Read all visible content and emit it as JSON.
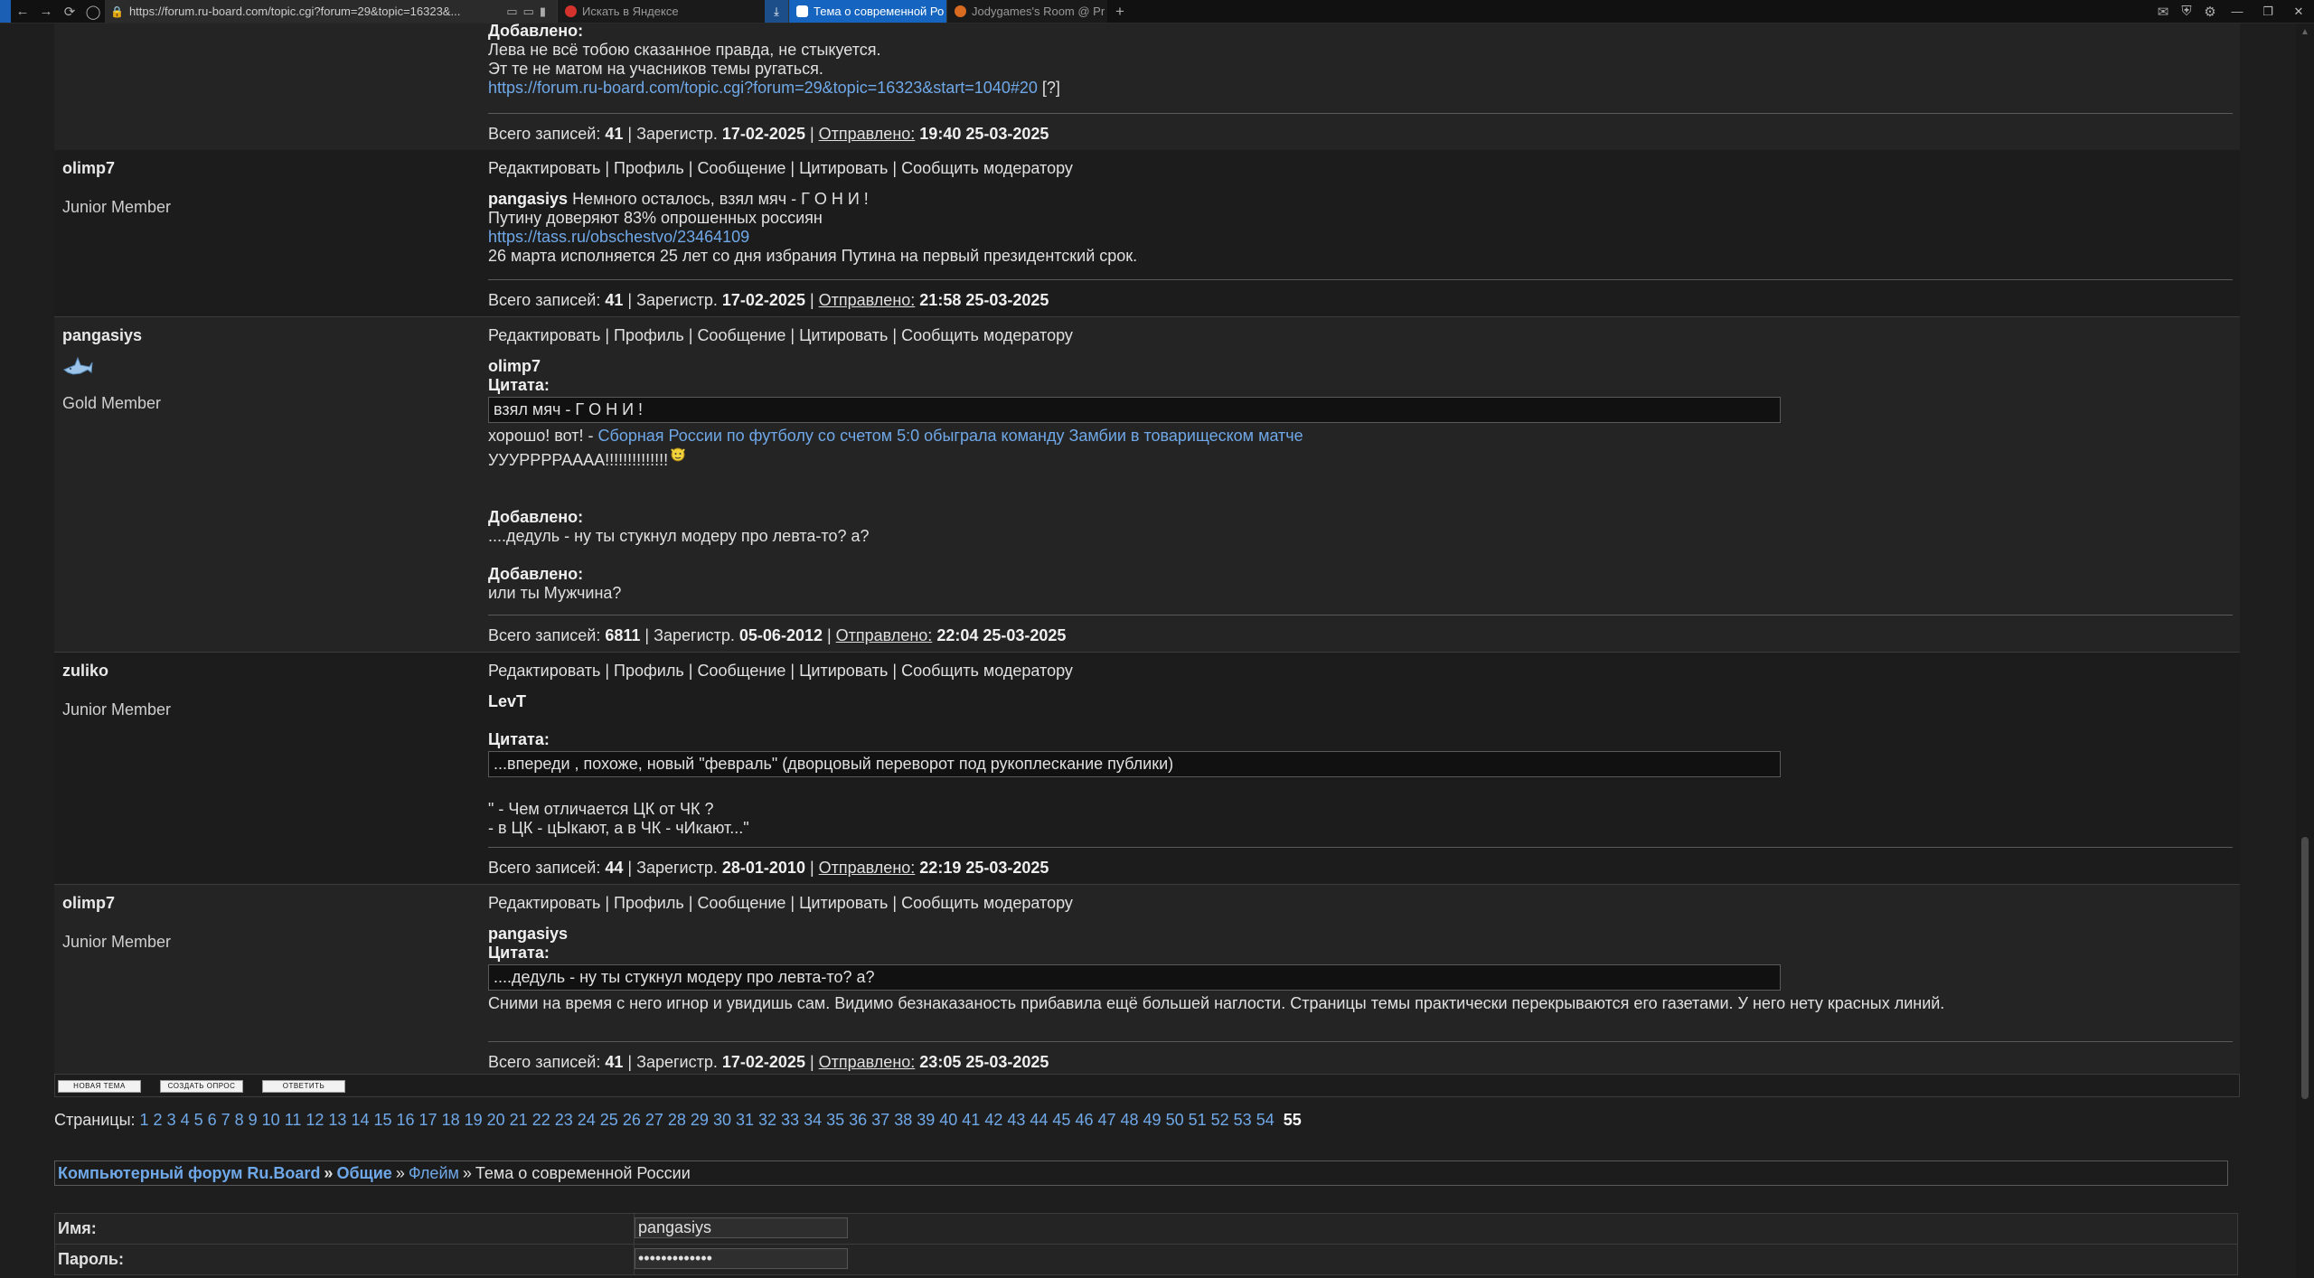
{
  "browser": {
    "url": "https://forum.ru-board.com/topic.cgi?forum=29&topic=16323&...",
    "tabs": [
      {
        "label": "Искать в Яндексе"
      },
      {
        "label": "Тема о современной Ро"
      },
      {
        "label": "Jodygames's Room @ Pr"
      }
    ],
    "new_tab": "+",
    "win_min": "—",
    "win_max": "❐",
    "win_close": "✕"
  },
  "actions": {
    "edit": "Редактировать",
    "profile": "Профиль",
    "message": "Сообщение",
    "quote": "Цитировать",
    "report": "Сообщить модератору",
    "sep": "|"
  },
  "footer_labels": {
    "total": "Всего записей:",
    "registered": "Зарегистр.",
    "sent": "Отправлено:"
  },
  "posts": [
    {
      "added_label": "Добавлено:",
      "line1": "Лева не всё тобою сказанное правда, не стыкуется.",
      "line2": "Эт те не матом на учасников темы ругаться.",
      "link": "https://forum.ru-board.com/topic.cgi?forum=29&topic=16323&start=1040#20",
      "link_suffix": "[?]",
      "total": "41",
      "reg": "17-02-2025",
      "sent": "19:40 25-03-2025"
    },
    {
      "nick": "olimp7",
      "rank": "Junior Member",
      "quote_author": "pangasiys",
      "line1": "Немного осталось, взял мяч - Г О Н И !",
      "line2": "Путину доверяют 83% опрошенных россиян",
      "link": "https://tass.ru/obschestvo/23464109",
      "line3": "26 марта исполняется 25 лет со дня избрания Путина на первый президентский срок.",
      "total": "41",
      "reg": "17-02-2025",
      "sent": "21:58 25-03-2025"
    },
    {
      "nick": "pangasiys",
      "rank": "Gold Member",
      "quote_author": "olimp7",
      "quote_label": "Цитата:",
      "quote_text": "взял мяч - Г О Н И !",
      "line1": "хорошо! вот! -",
      "link": "Сборная России по футболу со счетом 5:0 обыграла команду Замбии в товарищеском матче",
      "line2": "УУУРРРРАААА!!!!!!!!!!!!!!",
      "added1_label": "Добавлено:",
      "added1_text": "....дедуль - ну ты стукнул модеру про левта-то? а?",
      "added2_label": "Добавлено:",
      "added2_text": "или ты Мужчина?",
      "total": "6811",
      "reg": "05-06-2012",
      "sent": "22:04 25-03-2025"
    },
    {
      "nick": "zuliko",
      "rank": "Junior Member",
      "quote_author": "LevT",
      "quote_label": "Цитата:",
      "quote_text": "...впереди , похоже, новый \"февраль\" (дворцовый переворот под рукоплескание публики)",
      "line1": "\" - Чем отличается ЦК от ЧК ?",
      "line2": "- в ЦК - цЫкают, а в ЧК - чИкают...\"",
      "total": "44",
      "reg": "28-01-2010",
      "sent": "22:19 25-03-2025"
    },
    {
      "nick": "olimp7",
      "rank": "Junior Member",
      "quote_author": "pangasiys",
      "quote_label": "Цитата:",
      "quote_text": "....дедуль - ну ты стукнул модеру про левта-то? а?",
      "line1": "Сними на время с него игнор  и увидишь сам. Видимо безнаказаность прибавила ещё большей наглости. Страницы темы практически перекрываются его газетами. У него нету красных линий.",
      "total": "41",
      "reg": "17-02-2025",
      "sent": "23:05 25-03-2025"
    }
  ],
  "buttons": {
    "new_topic": "НОВАЯ ТЕМА",
    "new_poll": "СОЗДАТЬ ОПРОС",
    "reply": "ОТВЕТИТЬ"
  },
  "pagination": {
    "label": "Страницы:",
    "pages": [
      "1",
      "2",
      "3",
      "4",
      "5",
      "6",
      "7",
      "8",
      "9",
      "10",
      "11",
      "12",
      "13",
      "14",
      "15",
      "16",
      "17",
      "18",
      "19",
      "20",
      "21",
      "22",
      "23",
      "24",
      "25",
      "26",
      "27",
      "28",
      "29",
      "30",
      "31",
      "32",
      "33",
      "34",
      "35",
      "36",
      "37",
      "38",
      "39",
      "40",
      "41",
      "42",
      "43",
      "44",
      "45",
      "46",
      "47",
      "48",
      "49",
      "50",
      "51",
      "52",
      "53",
      "54"
    ],
    "current": "55"
  },
  "breadcrumb": {
    "forum": "Компьютерный форум Ru.Board",
    "section": "Общие",
    "subforum": "Флейм",
    "topic": "Тема о современной России",
    "arrow": "»"
  },
  "login": {
    "name_label": "Имя:",
    "name_value": "pangasiys",
    "password_label": "Пароль:",
    "password_value": "•••••••••••••"
  }
}
